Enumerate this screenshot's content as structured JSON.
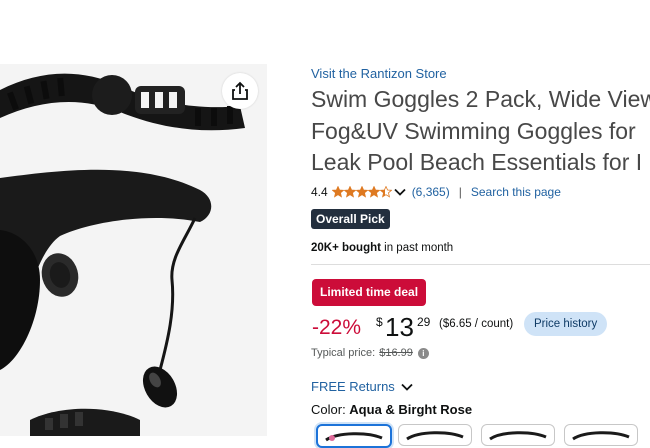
{
  "store": {
    "link": "Visit the Rantizon Store"
  },
  "product": {
    "title_lines": [
      "Swim Goggles 2 Pack, Wide View",
      "Fog&UV Swimming Goggles for",
      "Leak Pool Beach Essentials for I"
    ]
  },
  "rating": {
    "value": "4.4",
    "count": "(6,365)",
    "separator": "|",
    "search_link": "Search this page",
    "stars_icon": "star-rating-icon"
  },
  "badge": {
    "label": "Overall Pick"
  },
  "bought": {
    "bold": "20K+ bought",
    "rest": " in past month"
  },
  "deal": {
    "label": "Limited time deal"
  },
  "price": {
    "discount": "-22%",
    "currency": "$",
    "whole": "13",
    "fraction": "29",
    "unit_price": "($6.65 / count)",
    "history_button": "Price history",
    "typical_label": "Typical price:",
    "typical_value": "$16.99"
  },
  "returns": {
    "label": "FREE Returns"
  },
  "color": {
    "label": "Color: ",
    "value": "Aqua & Birght Rose"
  },
  "colors": {
    "accent_link": "#2162a1",
    "deal_red": "#cc0c39",
    "star_orange": "#de7921",
    "badge_dark": "#232f3e"
  }
}
